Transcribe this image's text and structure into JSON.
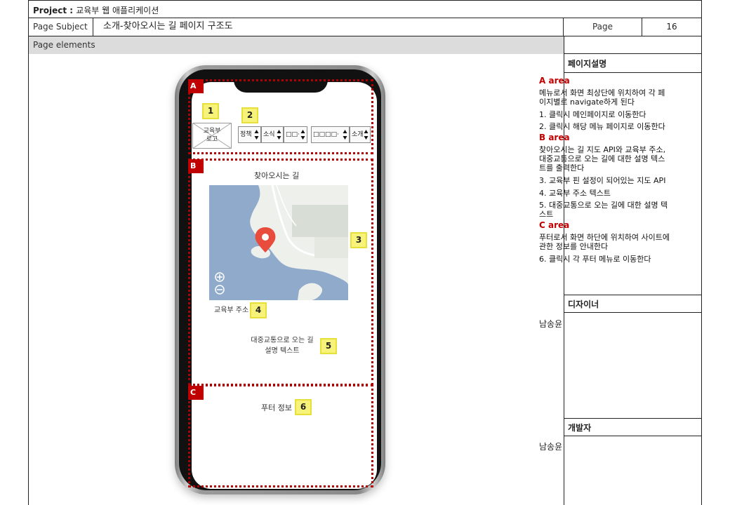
{
  "header": {
    "project_label": "Project : ",
    "project_value": "교육부 웹 애플리케이션",
    "subject_label": "Page Subject",
    "subject_value": "소개-찾아오시는 길 페이지 구조도",
    "page_label": "Page",
    "page_value": "16",
    "elements_label": "Page elements"
  },
  "phone": {
    "areas": [
      "A",
      "B",
      "C"
    ],
    "logo_text": [
      "교육부",
      "로고"
    ],
    "nav": [
      "정책",
      "소식",
      "□□·",
      "□□□□·",
      "소개"
    ],
    "map_title": "찾아오시는 길",
    "address": "교육부 주소",
    "transit_text": [
      "대중교통으로 오는 길",
      "설명 텍스트"
    ],
    "footer": "푸터 정보",
    "markers": [
      "1",
      "2",
      "3",
      "4",
      "5",
      "6"
    ]
  },
  "panel": {
    "desc_title": "페이지설명",
    "a_title": "A area",
    "a_desc": "메뉴로서 화면 최상단에 위치하여 각 페이지별로 navigate하게 된다",
    "a_1": "1.  클릭시 메인페이지로 이동한다",
    "a_2": "2. 클릭시 해당 메뉴 페이지로 이동한다",
    "b_title": "B area",
    "b_desc": "찾아오시는 길 지도 API와 교육부 주소, 대중교통으로 오는 길에 대한 설명 텍스트를 출력한다",
    "b_3": "3. 교육부 핀 설정이 되어있는 지도 API",
    "b_4": "4. 교육부 주소 텍스트",
    "b_5": "5. 대중교통으로 오는 길에 대한 설명 텍스트",
    "c_title": "C area",
    "c_desc": "푸터로서 화면 하단에 위치하여 사이트에 관한 정보를 안내한다",
    "c_6": "6.  클릭시 각 푸터 메뉴로 이동한다",
    "designer_title": "디자이너",
    "designer_name": "남송윤",
    "developer_title": "개발자",
    "developer_name": "남송윤"
  },
  "colors": {
    "area_red": "#c00000",
    "marker_yellow": "#f7f27a",
    "map_water": "#8faacb",
    "pin": "#e74c3c"
  },
  "icons": [
    "zoom-in-icon",
    "zoom-out-icon",
    "map-pin-icon",
    "up-down-arrow-icon"
  ]
}
